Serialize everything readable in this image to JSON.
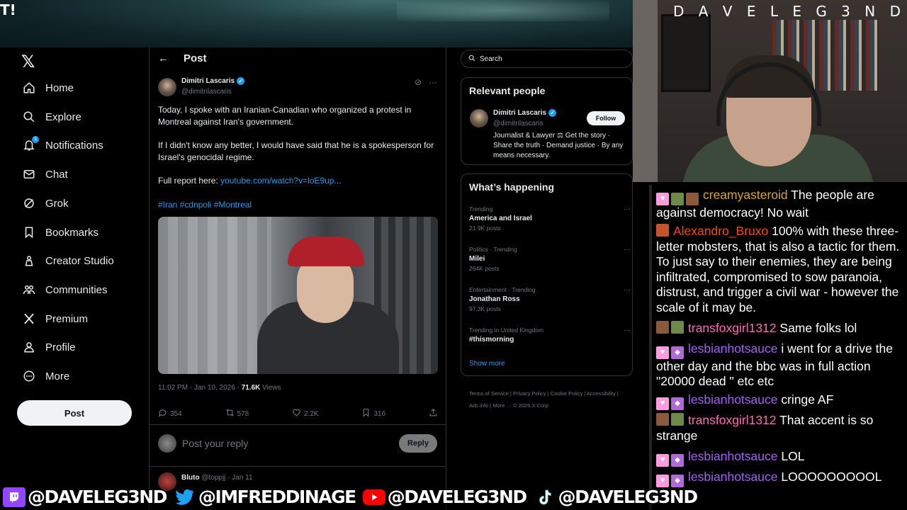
{
  "banner": {
    "text": "T!"
  },
  "stream": {
    "title": "D A V E L E G 3 N D"
  },
  "nav": {
    "items": [
      {
        "label": "Home",
        "icon": "home-icon"
      },
      {
        "label": "Explore",
        "icon": "search-icon"
      },
      {
        "label": "Notifications",
        "icon": "bell-icon",
        "badge": "1"
      },
      {
        "label": "Chat",
        "icon": "mail-icon"
      },
      {
        "label": "Grok",
        "icon": "grok-icon"
      },
      {
        "label": "Bookmarks",
        "icon": "bookmark-icon"
      },
      {
        "label": "Creator Studio",
        "icon": "creator-studio-icon"
      },
      {
        "label": "Communities",
        "icon": "communities-icon"
      },
      {
        "label": "Premium",
        "icon": "x-logo-icon"
      },
      {
        "label": "Profile",
        "icon": "person-icon"
      },
      {
        "label": "More",
        "icon": "more-circle-icon"
      }
    ],
    "post_label": "Post"
  },
  "post": {
    "header_title": "Post",
    "author_name": "Dimitri Lascaris",
    "author_handle": "@dimitrilascaris",
    "para1": "Today, I spoke with an Iranian-Canadian who organized a protest in Montreal against Iran's government.",
    "para2": "If I didn't know any better, I would have said that he is a spokesperson for Israel's genocidal regime.",
    "link_prefix": "Full report here: ",
    "link": "youtube.com/watch?v=loE9up...",
    "hashtags": "#Iran #cdnpoli #Montreal",
    "time": "11:02 PM · Jan 10, 2026 · ",
    "views": "71.6K",
    "views_label": " Views",
    "stats": {
      "replies": "354",
      "reposts": "578",
      "likes": "2.2K",
      "bookmarks": "316"
    },
    "reply_placeholder": "Post your reply",
    "reply_button": "Reply",
    "next_author": "Bluto",
    "next_handle": "@toppjj · Jan 11"
  },
  "sidebar": {
    "search_placeholder": "Search",
    "relevant_title": "Relevant people",
    "person_name": "Dimitri Lascaris",
    "person_handle": "@dimitrilascaris",
    "person_bio": "Journalist & Lawyer ⚖ Get the story · Share the truth · Demand justice · By any means necessary.",
    "follow_label": "Follow",
    "happening_title": "What’s happening",
    "trends": [
      {
        "context": "Trending",
        "name": "America and Israel",
        "count": "21.9K posts"
      },
      {
        "context": "Politics · Trending",
        "name": "Milei",
        "count": "264K posts"
      },
      {
        "context": "Entertainment · Trending",
        "name": "Jonathan Ross",
        "count": "97.3K posts"
      },
      {
        "context": "Trending in United Kingdom",
        "name": "#thismorning",
        "count": ""
      }
    ],
    "show_more": "Show more",
    "footer": "Terms of Service  |  Privacy Policy  |  Cookie Policy  |  Accessibility  |  Ads info  |  More ···  © 2026 X Corp."
  },
  "chat": {
    "messages": [
      {
        "user": "creamyasteroid",
        "text": " The people are against democracy! No wait"
      },
      {
        "user": "Alexandro_Bruxo",
        "text": " 100% with these three-letter mobsters, that is also a tactic for them. To just say to their enemies, they are being infiltrated, compromised to sow paranoia, distrust, and trigger a civil war - however the scale of it may be."
      },
      {
        "user": "transfoxgirl1312",
        "text": " Same folks lol"
      },
      {
        "user": "lesbianhotsauce",
        "text": " i went for a drive the other day and the bbc was in full action \"20000 dead \" etc etc"
      },
      {
        "user": "lesbianhotsauce",
        "text": " cringe AF"
      },
      {
        "user": "transfoxgirl1312",
        "text": " That accent is so strange"
      },
      {
        "user": "lesbianhotsauce",
        "text": " LOL"
      },
      {
        "user": "lesbianhotsauce",
        "text": " LOOOOOOOOOL"
      }
    ]
  },
  "socials": [
    {
      "platform": "twitch-icon",
      "handle": "@DAVELEG3ND"
    },
    {
      "platform": "twitter-icon",
      "handle": "@IMFREDDINAGE"
    },
    {
      "platform": "youtube-icon",
      "handle": "@DAVELEG3ND"
    },
    {
      "platform": "tiktok-icon",
      "handle": "@DAVELEG3ND"
    }
  ],
  "colors": {
    "x_blue": "#1d9bf0",
    "chat_creamy": "#daa520",
    "chat_alexandro": "#ff4500",
    "chat_transfox": "#ff69b4",
    "chat_lesbian": "#a35ef2"
  }
}
